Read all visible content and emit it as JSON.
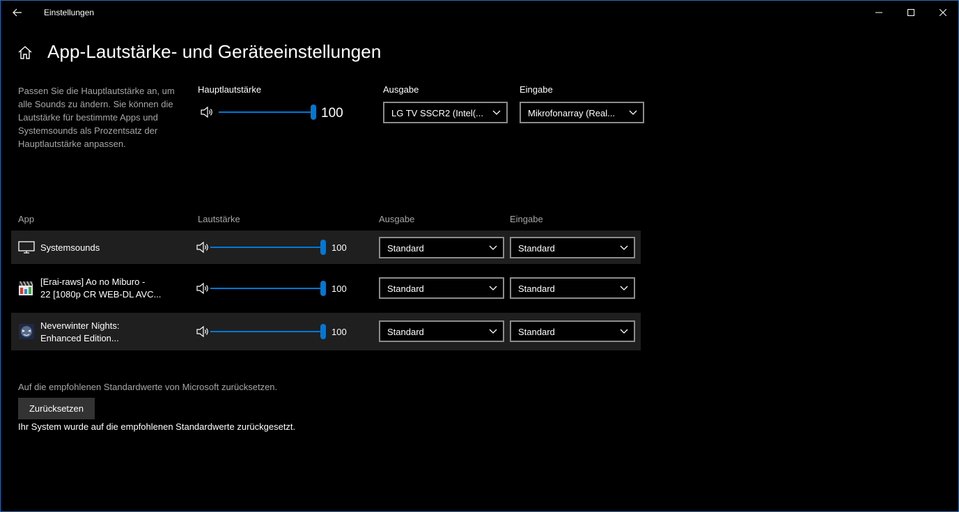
{
  "window": {
    "title": "Einstellungen"
  },
  "page": {
    "title": "App-Lautstärke- und Geräteeinstellungen"
  },
  "description": "Passen Sie die Hauptlautstärke an, um alle Sounds zu ändern. Sie können die Lautstärke für bestimmte Apps und Systemsounds als Prozentsatz der Hauptlautstärke anpassen.",
  "master": {
    "label": "Hauptlautstärke",
    "value": "100",
    "level": 100,
    "output_label": "Ausgabe",
    "output_value": "LG TV SSCR2 (Intel(...",
    "input_label": "Eingabe",
    "input_value": "Mikrofonarray (Real..."
  },
  "columns": {
    "app": "App",
    "volume": "Lautstärke",
    "output": "Ausgabe",
    "input": "Eingabe"
  },
  "apps": [
    {
      "name_line1": "Systemsounds",
      "name_line2": "",
      "value": "100",
      "level": 100,
      "output": "Standard",
      "input": "Standard",
      "icon": "monitor-icon"
    },
    {
      "name_line1": "[Erai-raws] Ao no Miburo -",
      "name_line2": "22 [1080p CR WEB-DL AVC...",
      "value": "100",
      "level": 100,
      "output": "Standard",
      "input": "Standard",
      "icon": "media-player-icon"
    },
    {
      "name_line1": "Neverwinter Nights:",
      "name_line2": "Enhanced Edition...",
      "value": "100",
      "level": 100,
      "output": "Standard",
      "input": "Standard",
      "icon": "game-icon"
    }
  ],
  "reset": {
    "text": "Auf die empfohlenen Standardwerte von Microsoft zurücksetzen.",
    "button_label": "Zurücksetzen",
    "status": "Ihr System wurde auf die empfohlenen Standardwerte zurückgesetzt."
  },
  "colors": {
    "accent": "#0078d7",
    "row_shade": "#1f1f1f",
    "border": "#8c8c8c"
  }
}
